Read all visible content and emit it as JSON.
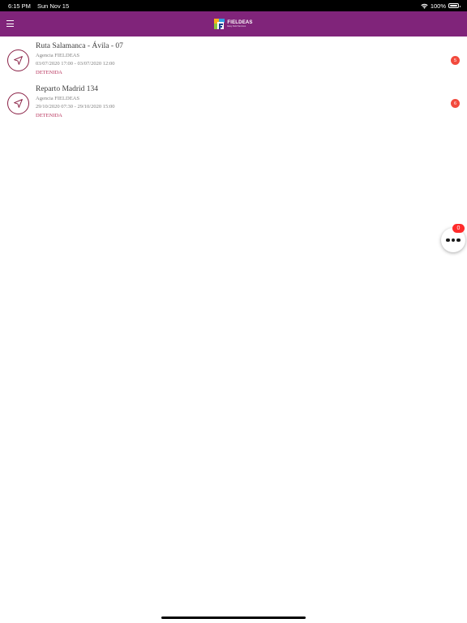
{
  "status_bar": {
    "time": "6:15 PM",
    "date": "Sun Nov 15",
    "battery": "100%",
    "icons": [
      "wifi-icon",
      "battery-icon"
    ]
  },
  "app_bar": {
    "background": "#80247a",
    "menu_icon": "hamburger-menu-icon",
    "logo_name": "FIELDEAS",
    "logo_tagline": "Easy Field Services"
  },
  "routes": [
    {
      "title": "Ruta Salamanca - Ávila - 07",
      "agency": "Agencia FIELDEAS",
      "dates": "03/07/2020 17:00 - 03/07/2020 12:00",
      "status": "DETENIDA",
      "badge": "5",
      "icon": "navigation-arrow-icon"
    },
    {
      "title": "Reparto Madrid 134",
      "agency": "Agencia FIELDEAS",
      "dates": "29/10/2020 07:30 - 29/10/2020 15:00",
      "status": "DETENIDA",
      "badge": "6",
      "icon": "navigation-arrow-icon"
    }
  ],
  "fab": {
    "icon": "more-dots-icon",
    "badge": "0"
  },
  "colors": {
    "accent": "#80247a",
    "status_text": "#b8335c",
    "badge": "#f24a3d"
  }
}
